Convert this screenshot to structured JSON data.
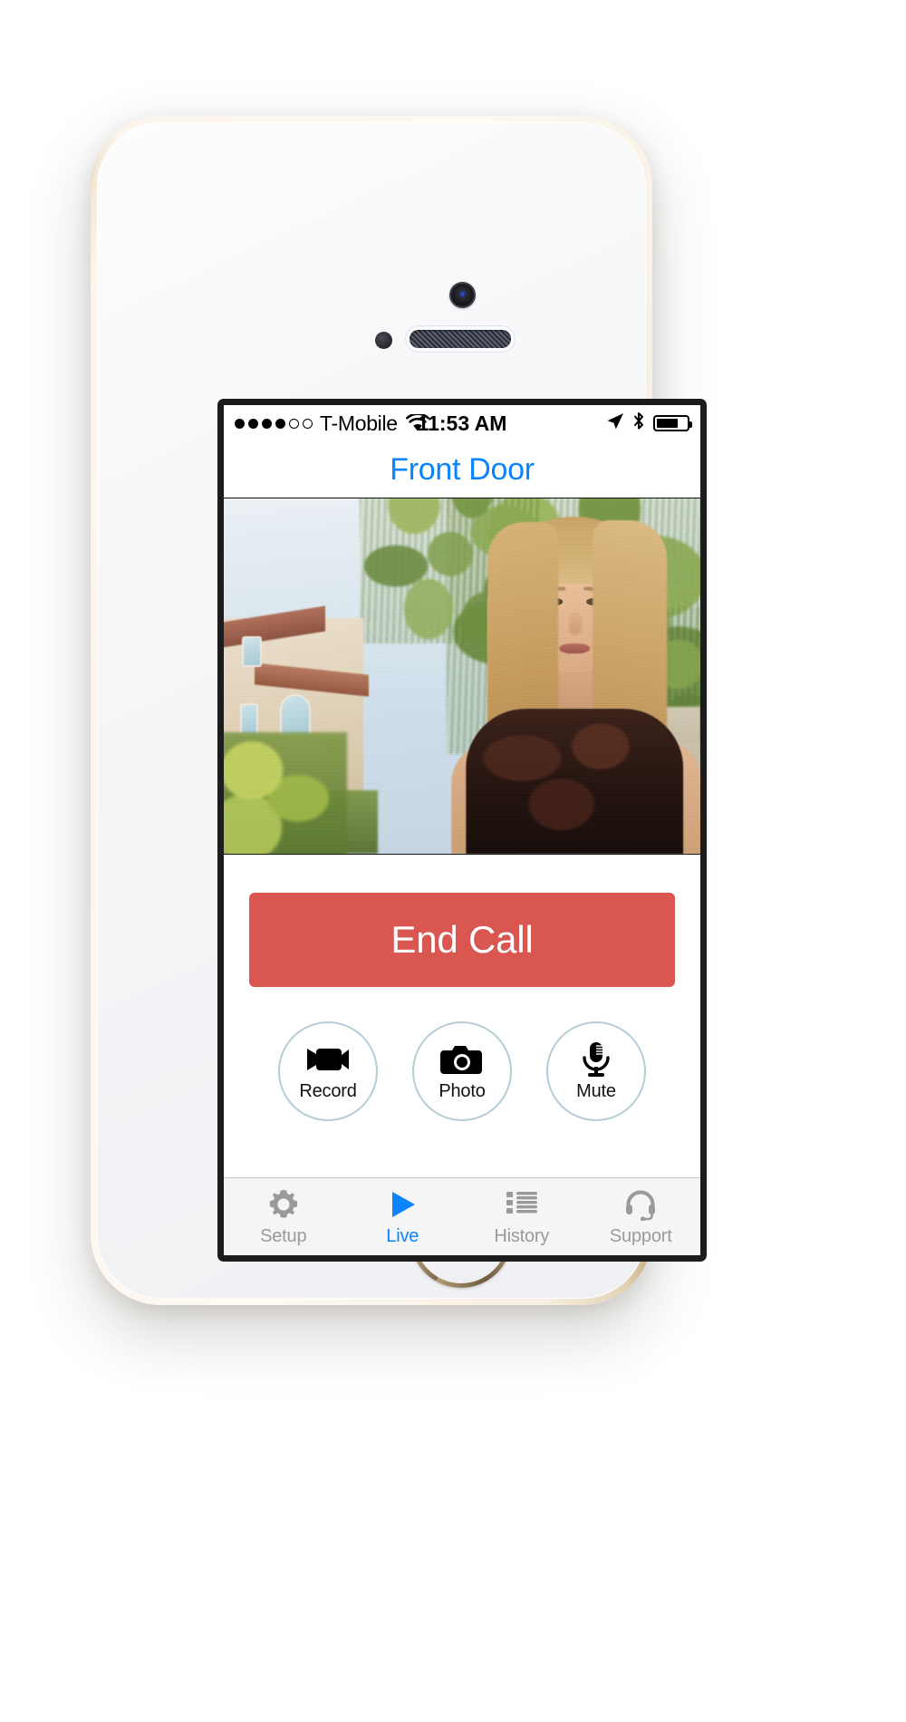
{
  "device": {
    "name": "iphone-5s-gold",
    "body_color": "#e9dcc2",
    "home_button_ring_color": "#c8ad80"
  },
  "status_bar": {
    "signal_dots_filled": 4,
    "signal_dots_total": 6,
    "carrier": "T-Mobile",
    "wifi_icon": "wifi-icon",
    "time": "11:53 AM",
    "location_icon": "location-arrow-icon",
    "bluetooth_icon": "bluetooth-icon",
    "battery_icon": "battery-icon",
    "battery_percent": 72
  },
  "nav_bar": {
    "title": "Front Door",
    "title_color": "#0a84ff"
  },
  "video": {
    "alt": "live-video-feed",
    "description": "Woman with long blonde hair in black floral sleeveless top standing outdoors in front of a suburban house and willow trees"
  },
  "controls": {
    "end_call_label": "End Call",
    "end_call_color": "#d95651",
    "actions": [
      {
        "id": "record",
        "label": "Record",
        "icon": "video-camera-icon"
      },
      {
        "id": "photo",
        "label": "Photo",
        "icon": "camera-icon"
      },
      {
        "id": "mute",
        "label": "Mute",
        "icon": "microphone-icon"
      }
    ],
    "action_border_color": "#b6ccd6"
  },
  "tab_bar": {
    "active_color": "#0a84ff",
    "inactive_color": "#9a9a9a",
    "tabs": [
      {
        "id": "setup",
        "label": "Setup",
        "icon": "gear-icon",
        "active": false
      },
      {
        "id": "live",
        "label": "Live",
        "icon": "play-icon",
        "active": true
      },
      {
        "id": "history",
        "label": "History",
        "icon": "list-icon",
        "active": false
      },
      {
        "id": "support",
        "label": "Support",
        "icon": "headset-icon",
        "active": false
      }
    ]
  }
}
